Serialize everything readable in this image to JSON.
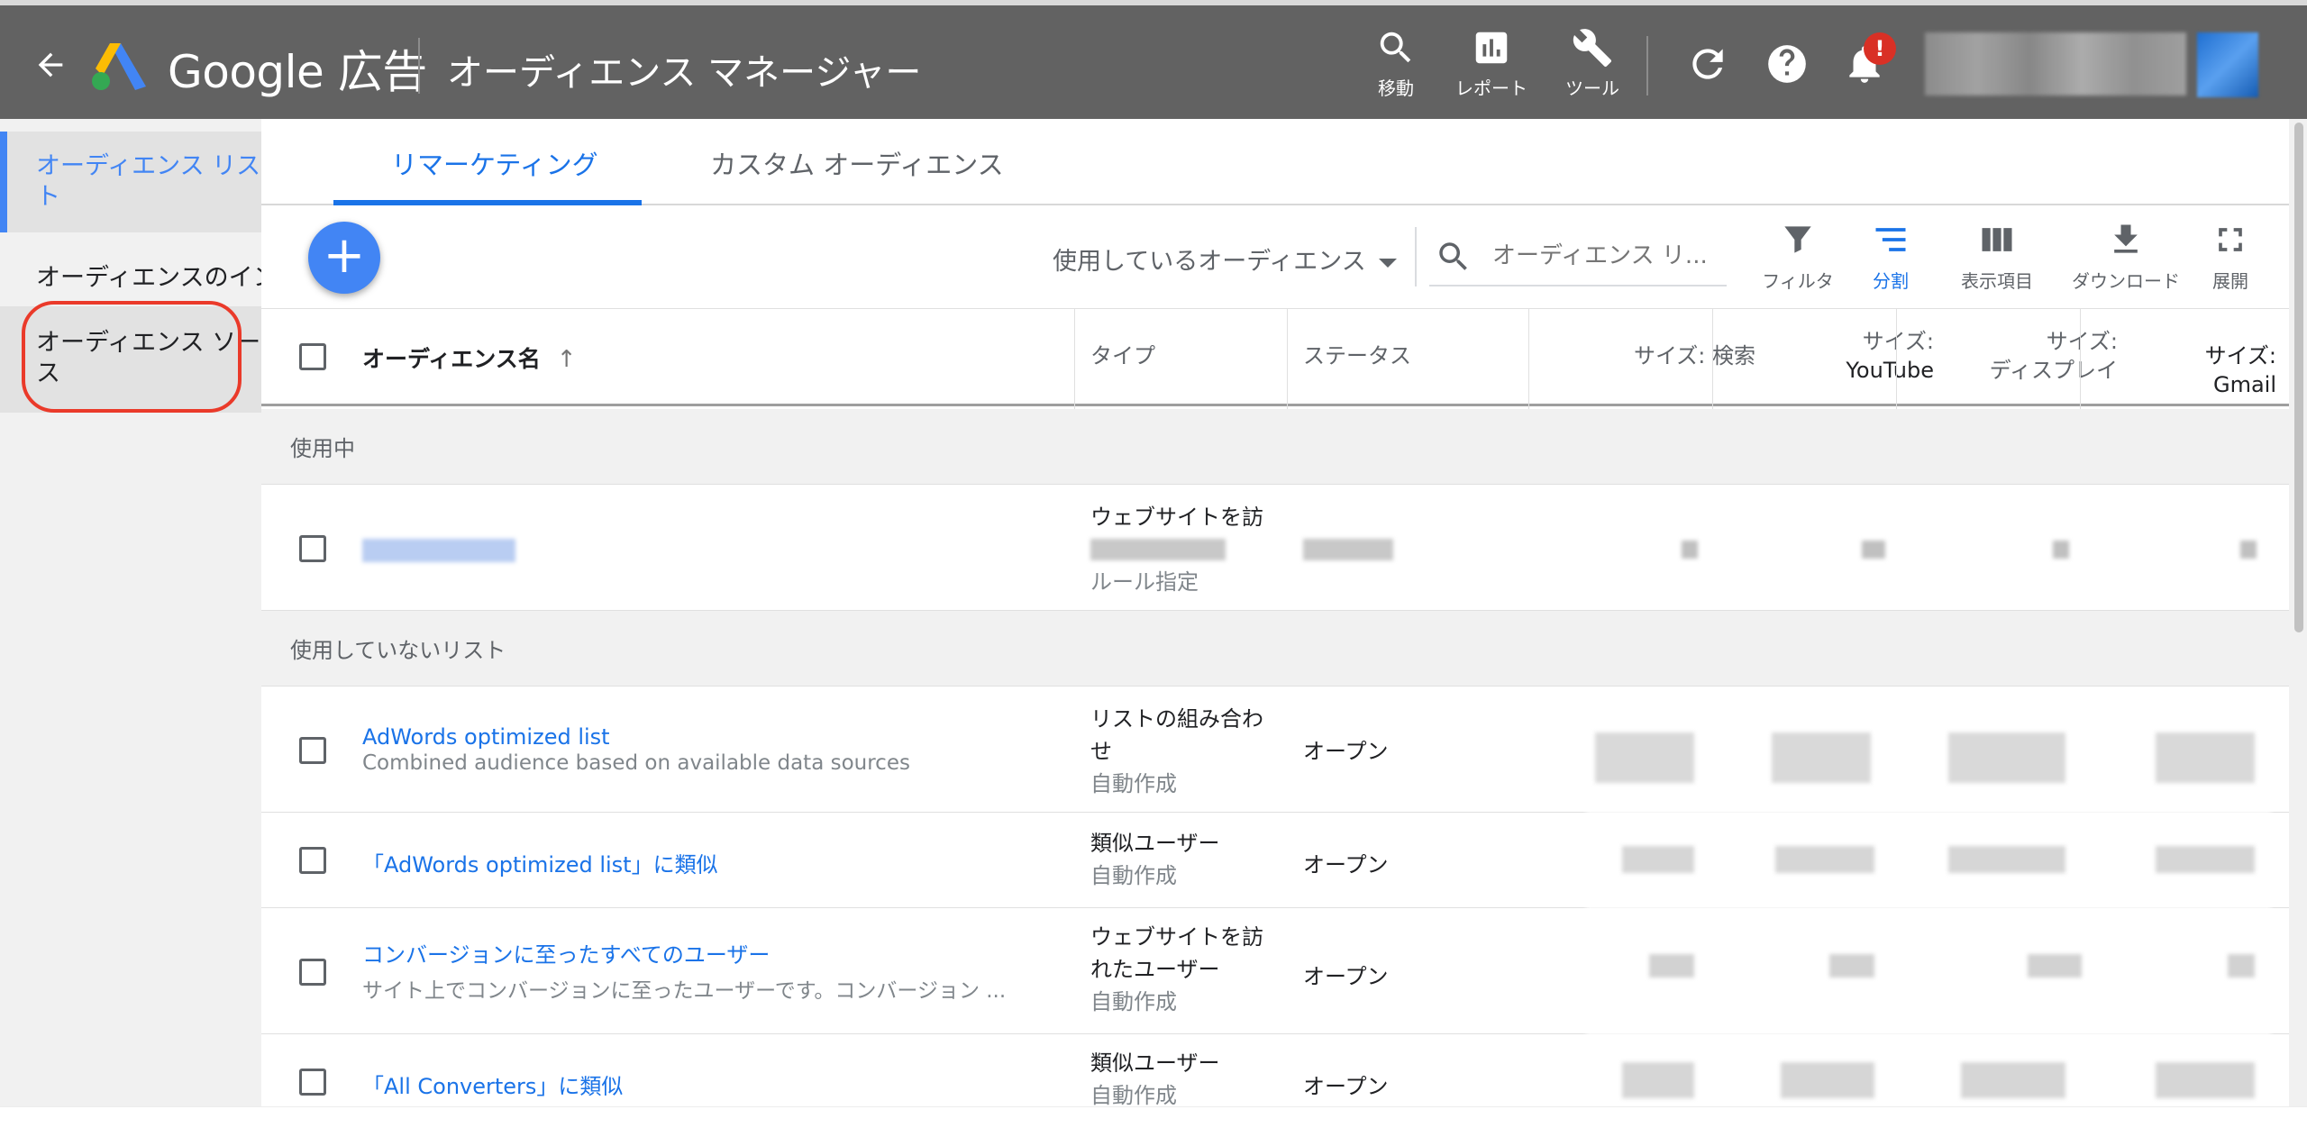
{
  "app": {
    "brand": "Google 広告",
    "page_title": "オーディエンス マネージャー"
  },
  "topbar": {
    "tools": [
      {
        "label": "移動",
        "icon": "search-icon"
      },
      {
        "label": "レポート",
        "icon": "report-chart-icon"
      },
      {
        "label": "ツール",
        "icon": "wrench-icon"
      }
    ],
    "notification_badge": "!"
  },
  "sidebar": {
    "items": [
      {
        "label": "オーディエンス リスト",
        "active": true
      },
      {
        "label": "オーディエンスのインサイト",
        "active": false
      },
      {
        "label": "オーディエンス ソース",
        "active": false,
        "highlighted": true
      }
    ]
  },
  "tabs": [
    {
      "label": "リマーケティング",
      "active": true
    },
    {
      "label": "カスタム オーディエンス",
      "active": false
    }
  ],
  "toolbar": {
    "add_label": "+",
    "audience_select": "使用しているオーディエンス",
    "search_placeholder": "オーディエンス リ...",
    "tools": [
      {
        "label": "フィルタ",
        "icon": "filter-icon"
      },
      {
        "label": "分割",
        "icon": "segment-icon",
        "active": true
      },
      {
        "label": "表示項目",
        "icon": "columns-icon"
      },
      {
        "label": "ダウンロード",
        "icon": "download-icon"
      },
      {
        "label": "展開",
        "icon": "fullscreen-icon"
      }
    ]
  },
  "table": {
    "headers": {
      "name": "オーディエンス名",
      "type": "タイプ",
      "status": "ステータス",
      "size_search": "サイズ: 検索",
      "size_youtube_1": "サイズ:",
      "size_youtube_2": "YouTube",
      "size_display_1": "サイズ:",
      "size_display_2": "ディスプレイ",
      "size_gmail": "サイズ: Gmail"
    },
    "section_in_use": "使用中",
    "section_unused": "使用していないリスト",
    "in_use_row": {
      "type_line1": "ウェブサイトを訪",
      "type_line3": "ルール指定"
    },
    "rows": [
      {
        "name": "AdWords optimized list",
        "sub": "Combined audience based on available data sources",
        "type_line1": "リストの組み合わ",
        "type_line2": "せ",
        "auto": "自動作成",
        "status": "オープン"
      },
      {
        "name": "「AdWords optimized list」に類似",
        "type_line1": "類似ユーザー",
        "auto": "自動作成",
        "status": "オープン"
      },
      {
        "name": "コンバージョンに至ったすべてのユーザー",
        "sub": "サイト上でコンバージョンに至ったユーザーです。コンバージョン ...",
        "type_line1": "ウェブサイトを訪",
        "type_line2": "れたユーザー",
        "auto": "自動作成",
        "status": "オープン"
      },
      {
        "name": "「All Converters」に類似",
        "type_line1": "類似ユーザー",
        "auto": "自動作成",
        "status": "オープン"
      }
    ]
  },
  "colors": {
    "topbar": "#626262",
    "accent_blue": "#4285f4",
    "link_blue": "#1a73e8",
    "highlight_red": "#ea3a2a",
    "badge_red": "#d93025"
  }
}
